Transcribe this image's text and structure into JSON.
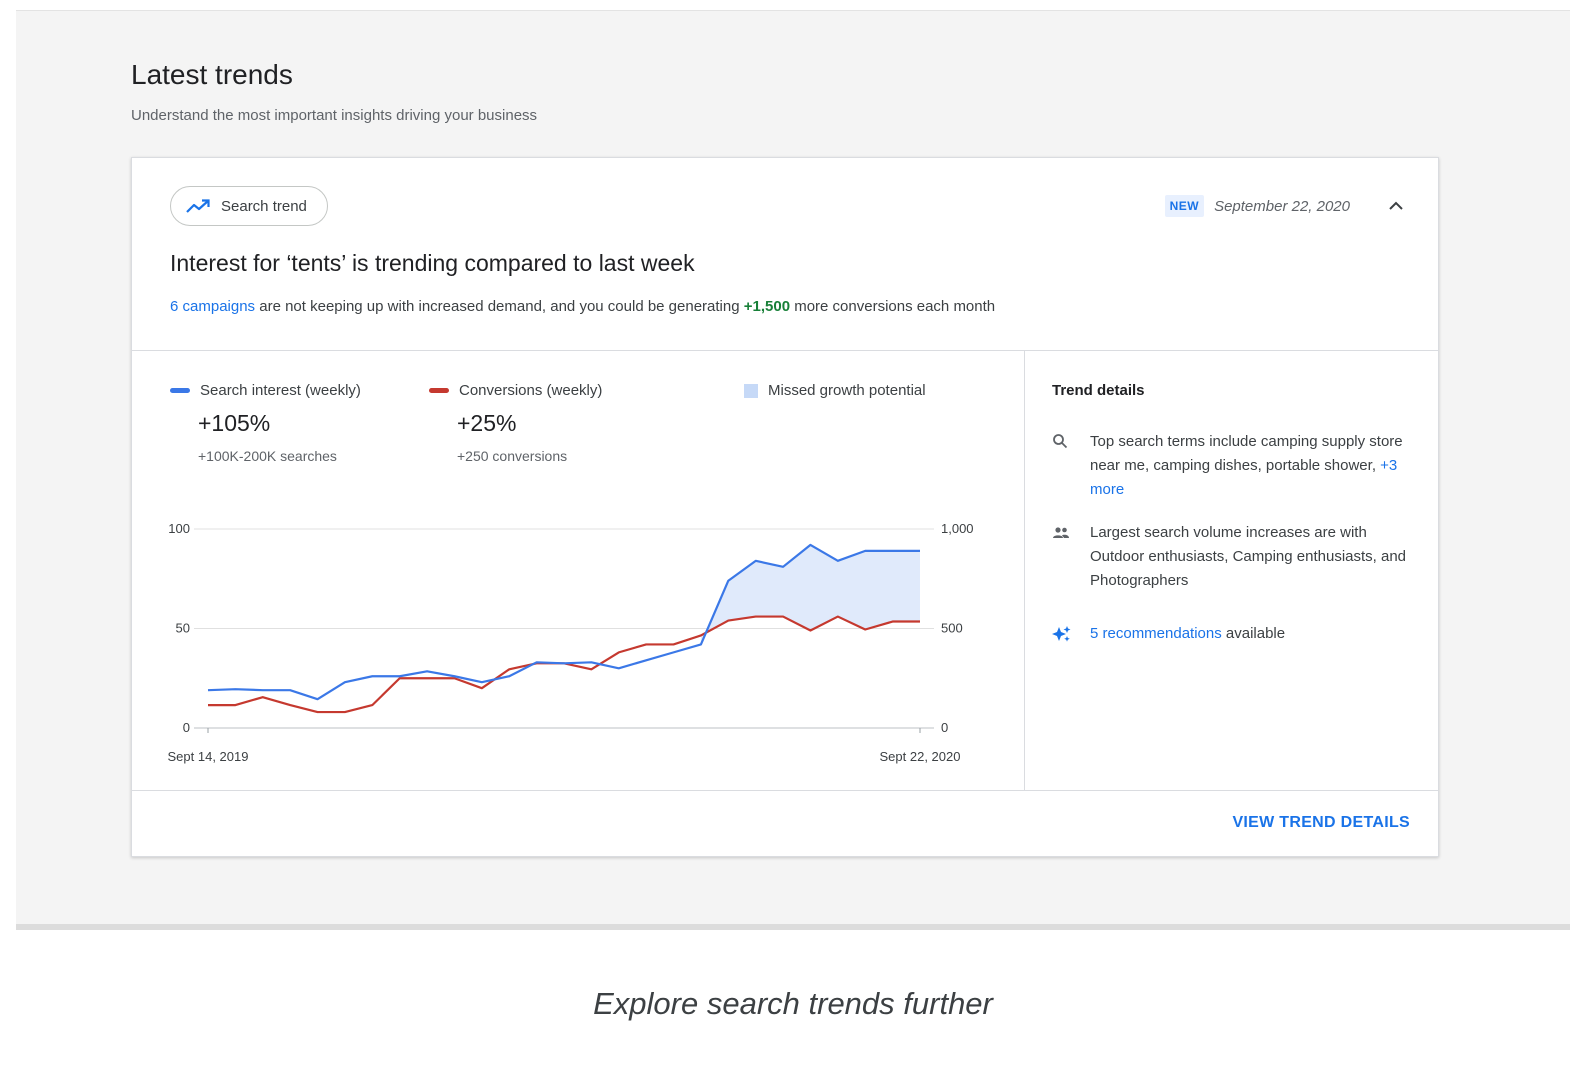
{
  "page": {
    "title": "Latest trends",
    "subtitle": "Understand the most important insights driving your business"
  },
  "card": {
    "chip_label": "Search trend",
    "badge": "NEW",
    "date": "September 22, 2020",
    "title": "Interest for ‘tents’ is trending compared to last week",
    "desc_link": "6 campaigns",
    "desc_mid": " are not keeping up with increased demand, and you could be generating ",
    "desc_highlight": "+1,500",
    "desc_end": " more conversions each month"
  },
  "legend": {
    "search": {
      "label": "Search interest (weekly)",
      "value": "+105%",
      "sub": "+100K-200K searches",
      "color": "#3b78e7"
    },
    "conversions": {
      "label": "Conversions (weekly)",
      "value": "+25%",
      "sub": "+250 conversions",
      "color": "#c5392f"
    },
    "missed": {
      "label": "Missed growth potential",
      "color": "#c6d9f7"
    }
  },
  "chart_data": {
    "type": "line",
    "x_start_label": "Sept 14, 2019",
    "x_end_label": "Sept 22, 2020",
    "left_axis": {
      "ticks": [
        "0",
        "50",
        "100"
      ],
      "ylim": [
        0,
        100
      ]
    },
    "right_axis": {
      "ticks": [
        "0",
        "500",
        "1,000"
      ],
      "ylim": [
        0,
        1000
      ]
    },
    "grid": true,
    "shaded_region": "Missed growth potential",
    "series": [
      {
        "name": "Search interest (weekly)",
        "axis": "left",
        "color": "#3b78e7",
        "values": [
          19,
          19.5,
          19,
          19,
          14.5,
          23,
          26,
          26,
          28.5,
          26,
          23,
          26,
          33,
          32.5,
          33,
          30,
          34,
          38,
          42,
          74,
          84,
          81,
          92,
          84,
          89,
          89,
          89
        ]
      },
      {
        "name": "Conversions (weekly)",
        "axis": "right",
        "color": "#c5392f",
        "values": [
          115,
          115,
          155,
          115,
          80,
          80,
          115,
          250,
          250,
          250,
          200,
          295,
          325,
          325,
          295,
          380,
          420,
          420,
          465,
          540,
          560,
          560,
          490,
          560,
          495,
          535,
          535
        ]
      }
    ]
  },
  "trend_details": {
    "title": "Trend details",
    "item1_text": "Top search terms include camping supply store near me, camping dishes, portable shower, ",
    "item1_link": "+3 more",
    "item2_text": "Largest search volume increases are with Outdoor enthusiasts, Camping enthusiasts, and Photographers",
    "item3_link": "5 recommendations",
    "item3_text": " available"
  },
  "footer": {
    "button": "VIEW TREND DETAILS"
  },
  "caption": "Explore search trends further"
}
